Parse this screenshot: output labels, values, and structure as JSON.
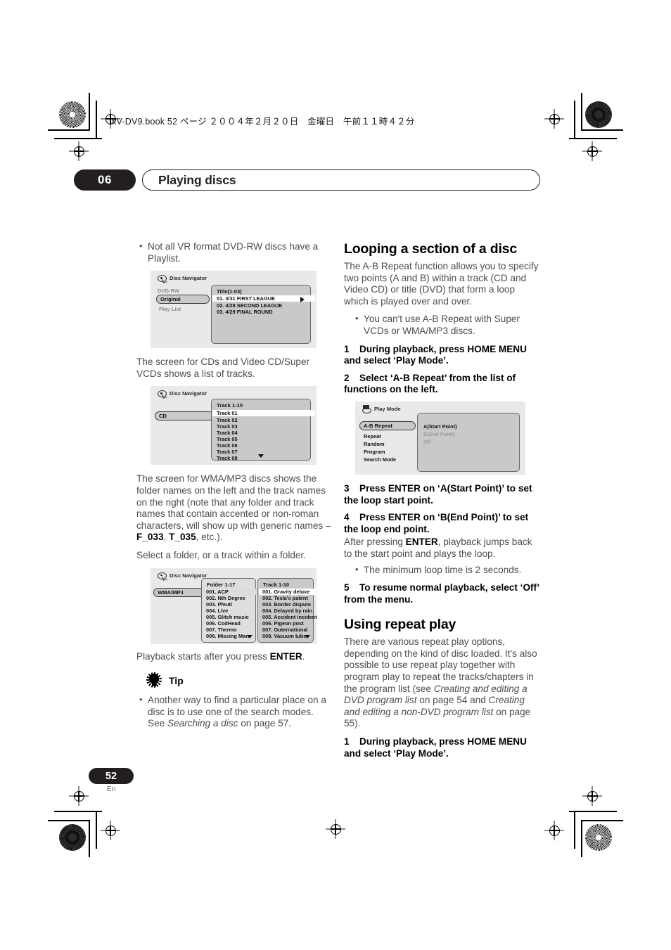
{
  "header": {
    "book_line": "XV-DV9.book  52 ページ  ２００４年２月２０日　金曜日　午前１１時４２分"
  },
  "chapter": {
    "number": "06",
    "title": "Playing discs"
  },
  "left_column": {
    "bullet_playlist": "Not all VR format DVD-RW discs have a Playlist.",
    "osd_dvdrw": {
      "window_title": "Disc Navigator",
      "icon": "disc-navigator-icon",
      "disc_label": "DVD-RW",
      "tab_selected": "Original",
      "menu_item": "Play List",
      "panel_header": "Title(1-03)",
      "rows": [
        "01. 3/31 FIRST LEAGUE",
        "02. 4/28 SECOND LEAGUE",
        "03. 4/29 FINAL ROUND"
      ]
    },
    "para_cd": "The screen for CDs and Video CD/Super VCDs shows a list of tracks.",
    "osd_cd": {
      "window_title": "Disc Navigator",
      "icon": "disc-navigator-icon",
      "tab_selected": "CD",
      "panel_header": "Track 1-10",
      "rows": [
        "Track 01",
        "Track 02",
        "Track 03",
        "Track 04",
        "Track 05",
        "Track 06",
        "Track 07",
        "Track 08"
      ],
      "scroll_indicator": "down-arrow-icon"
    },
    "para_wma_1": "The screen for WMA/MP3 discs shows the folder names on the left and the track names on the right (note that any folder and track names that contain accented or non-roman characters, will show up with generic names – ",
    "para_wma_bold1": "F_033",
    "para_wma_mid": ", ",
    "para_wma_bold2": "T_035",
    "para_wma_end": ", etc.).",
    "para_select_folder": "Select a folder, or a track within a folder.",
    "osd_wma": {
      "window_title": "Disc Navigator",
      "icon": "disc-navigator-icon",
      "tab_selected": "WMA/MP3",
      "folder_header": "Folder 1-17",
      "track_header": "Track 1-10",
      "folders": [
        "001. ACP",
        "002. Nth Degree",
        "003. Pfeuti",
        "004. Live",
        "005. Glitch music",
        "006. CodHead",
        "007. Thermo",
        "008. Missing Man"
      ],
      "tracks": [
        "001. Gravity deluxe",
        "002. Tesla's patent",
        "003. Border dispute",
        "004. Delayed by rain",
        "005. Accident incident",
        "006. Pigeon post",
        "007. Outernational",
        "008. Vacuum tube"
      ],
      "scroll_indicator": "down-arrow-icon"
    },
    "para_playback_pre": "Playback starts after you press ",
    "para_playback_bold": "ENTER",
    "para_playback_post": ".",
    "tip": {
      "icon": "tip-lightbulb-icon",
      "label": "Tip",
      "bullet_pre": "Another way to find a particular place on a disc is to use one of the search modes. See ",
      "bullet_italic": "Searching a disc",
      "bullet_post": " on page 57."
    }
  },
  "right_column": {
    "heading_looping": "Looping a section of a disc",
    "para_looping": "The A-B Repeat function allows you to specify two points (A and B) within a track (CD and Video CD) or title (DVD) that form a loop which is played over and over.",
    "bullet_superv cd": "",
    "bullet_supervcd": "You can't use A-B Repeat with Super VCDs or WMA/MP3 discs.",
    "step1_n": "1",
    "step1": "During playback, press HOME MENU and select ‘Play Mode’.",
    "step2_n": "2",
    "step2": "Select ‘A-B Repeat’ from the list of functions on the left.",
    "osd_playmode": {
      "window_title": "Play Mode",
      "icon": "play-mode-icon",
      "menu_items": [
        "A-B Repeat",
        "Repeat",
        "Random",
        "Program",
        "Search Mode"
      ],
      "selected_menu_item": "A-B Repeat",
      "options": [
        "A(Start Point)",
        "B(End Point)",
        "Off"
      ],
      "options_enabled": [
        "A(Start Point)"
      ]
    },
    "step3_n": "3",
    "step3": "Press ENTER on ‘A(Start Point)’ to set the loop start point.",
    "step4_n": "4",
    "step4": "Press ENTER on ‘B(End Point)’ to set the loop end point.",
    "para_after_pre": "After pressing ",
    "para_after_bold": "ENTER",
    "para_after_post": ", playback jumps back to the start point and plays the loop.",
    "bullet_minloop": "The minimum loop time is 2 seconds.",
    "step5_n": "5",
    "step5": "To resume normal playback, select ‘Off’ from the menu.",
    "heading_repeat": "Using repeat play",
    "para_repeat_1": "There are various repeat play options, depending on the kind of disc loaded. It's also possible to use repeat play together with program play to repeat the tracks/chapters in the program list (see ",
    "para_repeat_it1": "Creating and editing a DVD program list",
    "para_repeat_2": " on page 54 and ",
    "para_repeat_it2": "Creating and editing a non-DVD program list",
    "para_repeat_3": " on page 55).",
    "step_r1_n": "1",
    "step_r1": "During playback, press HOME MENU and select ‘Play Mode’."
  },
  "footer": {
    "page_number": "52",
    "language": "En"
  }
}
